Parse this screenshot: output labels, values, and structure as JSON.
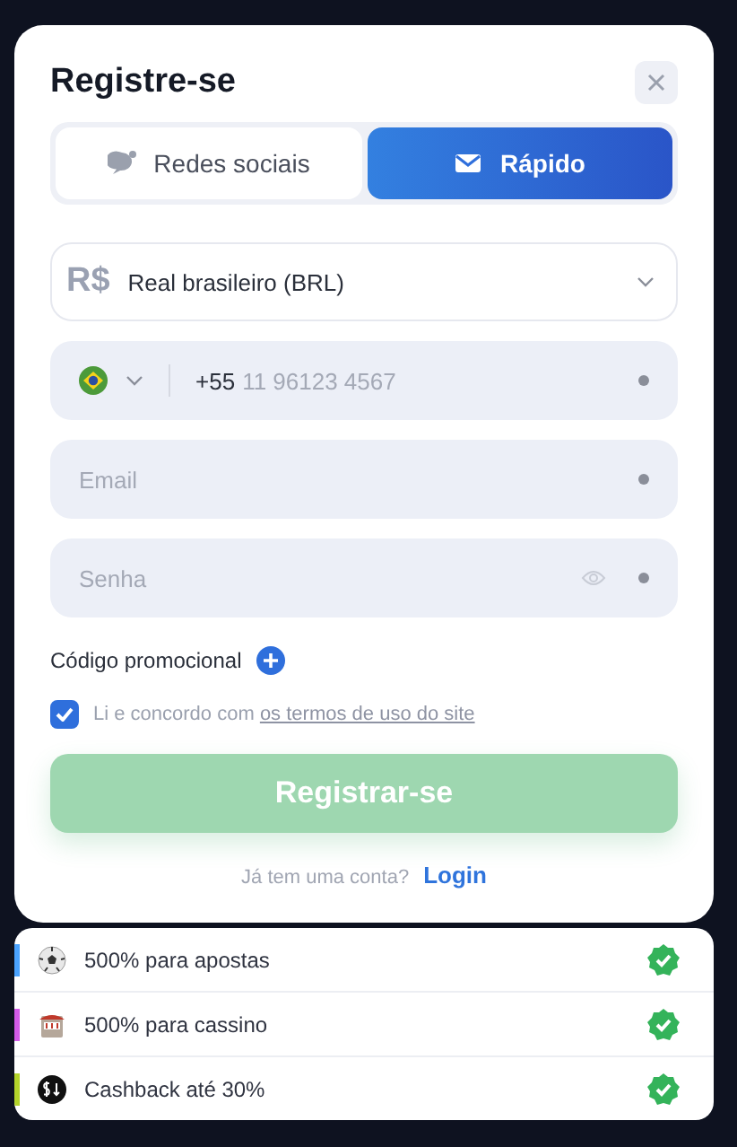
{
  "dialog": {
    "title": "Registre-se",
    "tabs": [
      {
        "label": "Redes sociais",
        "kind": "social",
        "selected": false
      },
      {
        "label": "Rápido",
        "kind": "email",
        "selected": true
      }
    ],
    "currency": {
      "symbol": "R$",
      "value": "Real brasileiro (BRL)"
    },
    "phone": {
      "code": "+55",
      "placeholder": "11 96123 4567"
    },
    "email": {
      "placeholder": "Email"
    },
    "password": {
      "placeholder": "Senha"
    },
    "promo_label": "Código promocional",
    "terms": {
      "checked": true,
      "text": "Li e concordo com",
      "link": "os termos de uso do site"
    },
    "submit": {
      "label": "Registrar-se",
      "disabled": true
    },
    "login_prompt": {
      "text": "Já tem uma conta?",
      "link": "Login"
    }
  },
  "bonuses": [
    {
      "kind": "sport",
      "label": "500% para apostas",
      "color": "#4aa3ff",
      "checked": true
    },
    {
      "kind": "casino",
      "label": "500% para cassino",
      "color": "#d35be8",
      "checked": true
    },
    {
      "kind": "cashback",
      "label": "Cashback até 30%",
      "color": "#b3d32a",
      "checked": true
    }
  ]
}
